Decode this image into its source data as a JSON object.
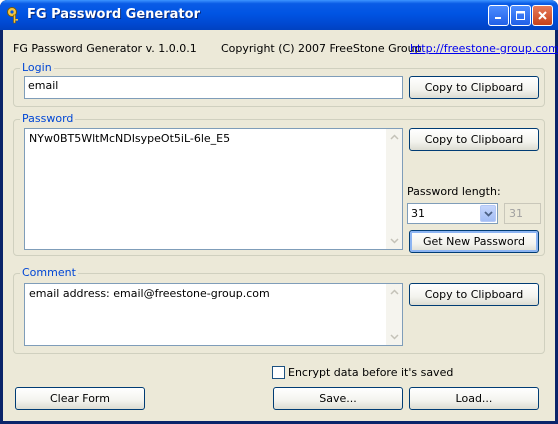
{
  "window": {
    "title": "FG Password Generator"
  },
  "info": {
    "version": "FG Password Generator v. 1.0.0.1",
    "copyright": "Copyright (C) 2007 FreeStone Group",
    "url": "http://freestone-group.com"
  },
  "login": {
    "label": "Login",
    "value": "email",
    "copy_label": "Copy to Clipboard"
  },
  "password": {
    "label": "Password",
    "value": "NYw0BT5WltMcNDIsypeOt5iL-6le_E5",
    "copy_label": "Copy to Clipboard",
    "length_label": "Password length:",
    "length_value": "31",
    "length_display": "31",
    "generate_label": "Get New Password"
  },
  "comment": {
    "label": "Comment",
    "value": "email address: email@freestone-group.com",
    "copy_label": "Copy to Clipboard"
  },
  "encrypt": {
    "label": "Encrypt data before it's saved",
    "checked": false
  },
  "actions": {
    "clear_label": "Clear Form",
    "save_label": "Save...",
    "load_label": "Load..."
  },
  "colors": {
    "titlebar": "#0054e3",
    "group_label": "#0046d5",
    "client_bg": "#ece9d8"
  }
}
